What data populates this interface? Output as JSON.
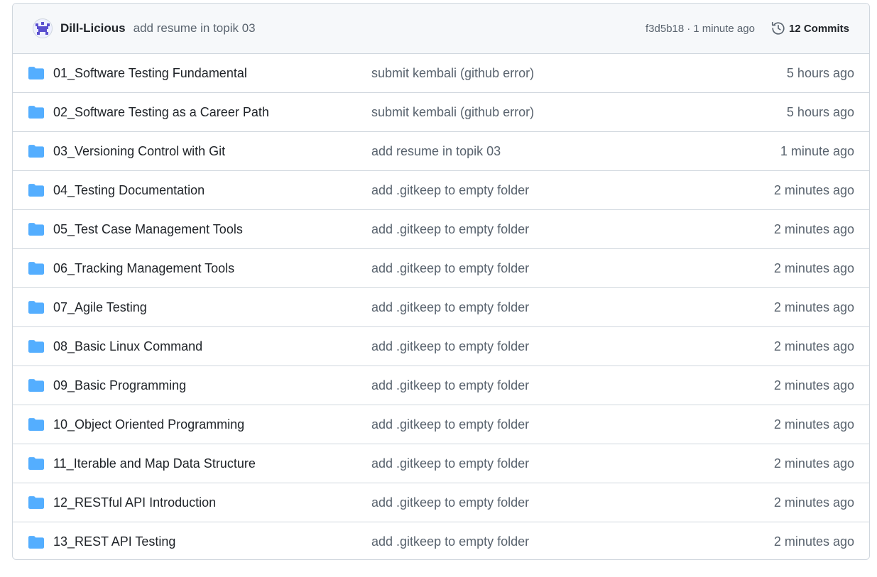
{
  "latest_commit": {
    "author": "Dill-Licious",
    "message": "add resume in topik 03",
    "sha": "f3d5b18",
    "separator": "·",
    "time": "1 minute ago",
    "commits_label": "12 Commits",
    "avatar_icon": "pixel-avatar-icon",
    "history_icon": "history-clock-icon"
  },
  "colors": {
    "folder": "#54aeff",
    "muted_text": "#59636e",
    "header_bg": "#f6f8fa",
    "border": "#d0d7de",
    "avatar": "#5a4fcf"
  },
  "files": [
    {
      "name": "01_Software Testing Fundamental",
      "message": "submit kembali (github error)",
      "time": "5 hours ago",
      "icon": "folder-icon"
    },
    {
      "name": "02_Software Testing as a Career Path",
      "message": "submit kembali (github error)",
      "time": "5 hours ago",
      "icon": "folder-icon"
    },
    {
      "name": "03_Versioning Control with Git",
      "message": "add resume in topik 03",
      "time": "1 minute ago",
      "icon": "folder-icon"
    },
    {
      "name": "04_Testing Documentation",
      "message": "add .gitkeep to empty folder",
      "time": "2 minutes ago",
      "icon": "folder-icon"
    },
    {
      "name": "05_Test Case Management Tools",
      "message": "add .gitkeep to empty folder",
      "time": "2 minutes ago",
      "icon": "folder-icon"
    },
    {
      "name": "06_Tracking Management Tools",
      "message": "add .gitkeep to empty folder",
      "time": "2 minutes ago",
      "icon": "folder-icon"
    },
    {
      "name": "07_Agile Testing",
      "message": "add .gitkeep to empty folder",
      "time": "2 minutes ago",
      "icon": "folder-icon"
    },
    {
      "name": "08_Basic Linux Command",
      "message": "add .gitkeep to empty folder",
      "time": "2 minutes ago",
      "icon": "folder-icon"
    },
    {
      "name": "09_Basic Programming",
      "message": "add .gitkeep to empty folder",
      "time": "2 minutes ago",
      "icon": "folder-icon"
    },
    {
      "name": "10_Object Oriented Programming",
      "message": "add .gitkeep to empty folder",
      "time": "2 minutes ago",
      "icon": "folder-icon"
    },
    {
      "name": "11_Iterable and Map Data Structure",
      "message": "add .gitkeep to empty folder",
      "time": "2 minutes ago",
      "icon": "folder-icon"
    },
    {
      "name": "12_RESTful API Introduction",
      "message": "add .gitkeep to empty folder",
      "time": "2 minutes ago",
      "icon": "folder-icon"
    },
    {
      "name": "13_REST API Testing",
      "message": "add .gitkeep to empty folder",
      "time": "2 minutes ago",
      "icon": "folder-icon"
    }
  ]
}
